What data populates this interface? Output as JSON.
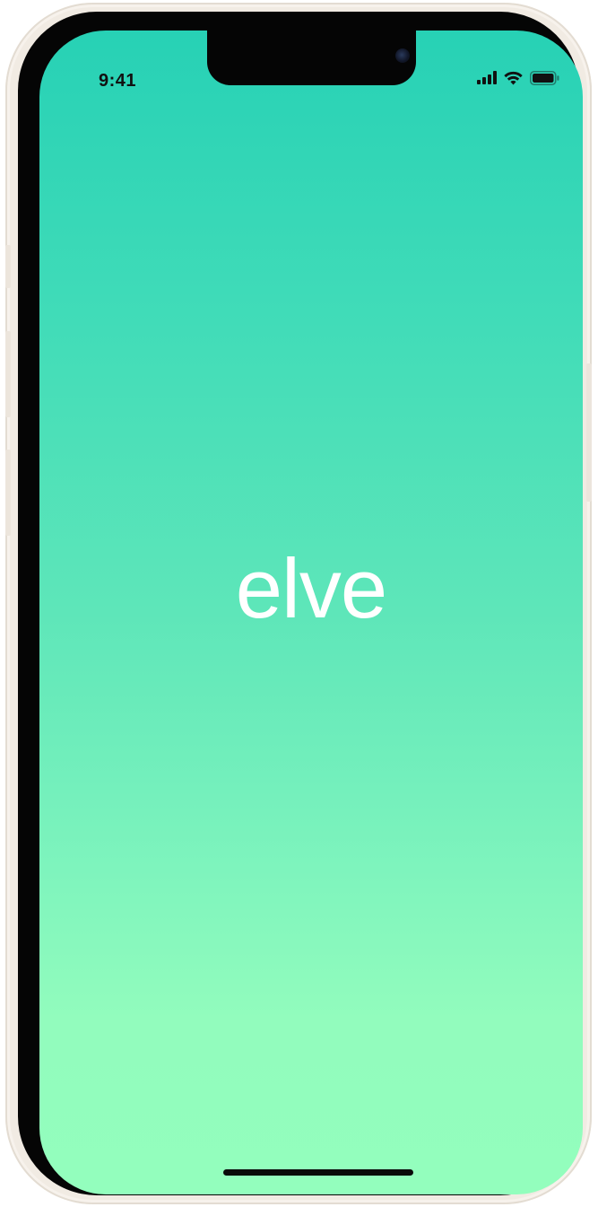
{
  "status_bar": {
    "time": "9:41",
    "icons": [
      "cellular-signal-icon",
      "wifi-icon",
      "battery-icon"
    ]
  },
  "splash": {
    "logo_text": "elve"
  },
  "colors": {
    "gradient_top": "#27d1b5",
    "gradient_bottom": "#93febd",
    "logo": "#ffffff",
    "frame": "#f1ebe3"
  }
}
